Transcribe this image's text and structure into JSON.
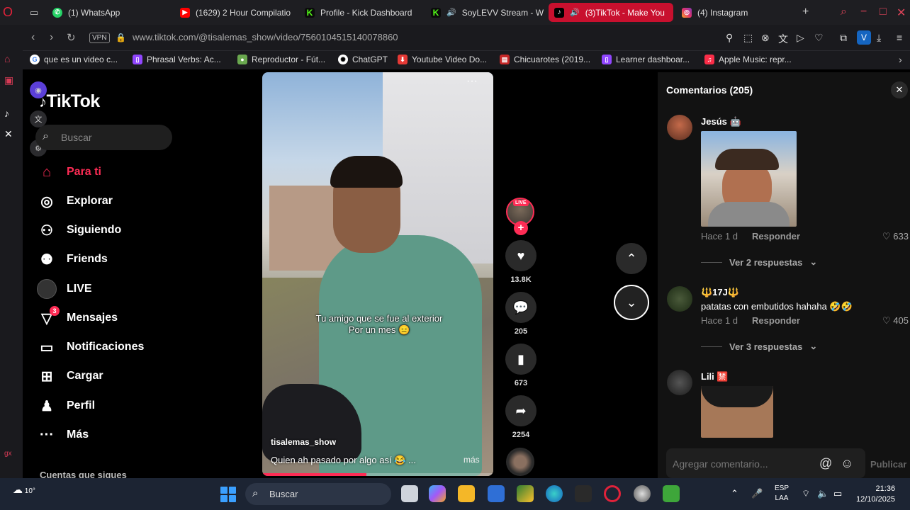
{
  "browser": {
    "tabs": [
      {
        "label": "(1) WhatsApp",
        "icon": "whatsapp-icon",
        "color": "#25d366"
      },
      {
        "label": "(1629) 2 Hour Compilatio",
        "icon": "youtube-icon",
        "color": "#ff0000"
      },
      {
        "label": "Profile - Kick Dashboard",
        "icon": "kick-icon",
        "color": "#53fc18"
      },
      {
        "label": "SoyLEVV Stream - W",
        "icon": "kick-icon",
        "color": "#53fc18"
      },
      {
        "label": "(3)TikTok - Make You",
        "icon": "tiktok-icon",
        "color": "#000000",
        "active": true
      },
      {
        "label": "(4) Instagram",
        "icon": "instagram-icon",
        "color": "#e1306c"
      }
    ],
    "url": "www.tiktok.com/@tisalemas_show/video/7560104515140078860",
    "vpn_label": "VPN",
    "profile_initial": "V",
    "bookmarks": [
      {
        "label": "que es un video c...",
        "icon": "google-icon",
        "color": "#4285f4"
      },
      {
        "label": "Phrasal Verbs: Ac...",
        "icon": "twitch-icon",
        "color": "#9146ff"
      },
      {
        "label": "Reproductor - Fút...",
        "icon": "reproductor-icon",
        "color": "#6aa84f"
      },
      {
        "label": "ChatGPT",
        "icon": "chatgpt-icon",
        "color": "#ffffff"
      },
      {
        "label": "Youtube Video Do...",
        "icon": "download-icon",
        "color": "#e53935"
      },
      {
        "label": "Chicuarotes (2019...",
        "icon": "page-icon",
        "color": "#c62828"
      },
      {
        "label": "Learner dashboar...",
        "icon": "twitch-icon",
        "color": "#9146ff"
      },
      {
        "label": "Apple Music: repr...",
        "icon": "music-icon",
        "color": "#fa2d48"
      }
    ]
  },
  "tiktok": {
    "logo": "TikTok",
    "search_placeholder": "Buscar",
    "nav": [
      {
        "label": "Para ti",
        "icon": "home-icon",
        "active": true
      },
      {
        "label": "Explorar",
        "icon": "compass-icon"
      },
      {
        "label": "Siguiendo",
        "icon": "following-icon"
      },
      {
        "label": "Friends",
        "icon": "friends-icon"
      },
      {
        "label": "LIVE",
        "icon": "live-icon"
      },
      {
        "label": "Mensajes",
        "icon": "messages-icon",
        "badge": "3"
      },
      {
        "label": "Notificaciones",
        "icon": "notifications-icon"
      },
      {
        "label": "Cargar",
        "icon": "upload-icon"
      },
      {
        "label": "Perfil",
        "icon": "profile-icon"
      },
      {
        "label": "Más",
        "icon": "more-icon"
      }
    ],
    "following_header": "Cuentas que sigues",
    "video": {
      "overlay_text_line1": "Tu amigo que se fue al exterior",
      "overlay_text_line2": "Por un mes 😑",
      "author": "tisalemas_show",
      "description": "Quien ah pasado por algo así 😂 ...",
      "more_label": "más",
      "progress": 0.45
    },
    "actions": {
      "live_tag": "LIVE",
      "likes": "13.8K",
      "comments": "205",
      "saves": "673",
      "shares": "2254"
    }
  },
  "comments": {
    "title": "Comentarios (205)",
    "items": [
      {
        "name": "Jesús 🤖",
        "text": "",
        "time": "Hace 1 d",
        "reply": "Responder",
        "likes": "633",
        "more": "Ver 2 respuestas"
      },
      {
        "name": "🔱17J🔱",
        "text": "patatas con embutidos hahaha 🤣🤣",
        "time": "Hace 1 d",
        "reply": "Responder",
        "likes": "405",
        "more": "Ver 3 respuestas"
      },
      {
        "name": "Lili 🈲",
        "text": ""
      }
    ],
    "input_placeholder": "Agregar comentario...",
    "publish_label": "Publicar"
  },
  "taskbar": {
    "weather": "10°",
    "search_placeholder": "Buscar",
    "lang_line1": "ESP",
    "lang_line2": "LAA",
    "time": "21:36",
    "date": "12/10/2025"
  }
}
